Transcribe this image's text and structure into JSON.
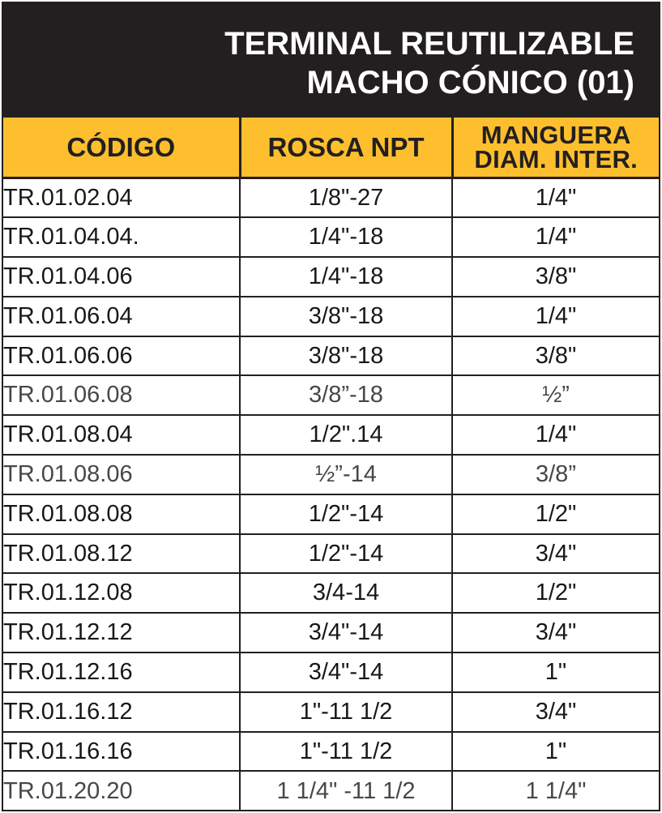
{
  "title": {
    "line1": "TERMINAL REUTILIZABLE",
    "line2": "MACHO CÓNICO (01)"
  },
  "headers": {
    "code": "CÓDIGO",
    "thread": "ROSCA NPT",
    "hose_line1": "MANGUERA",
    "hose_line2": "DIAM. INTER."
  },
  "rows": [
    {
      "code": "TR.01.02.04",
      "thread": "1/8\"-27",
      "hose": "1/4\""
    },
    {
      "code": "TR.01.04.04.",
      "thread": "1/4\"-18",
      "hose": "1/4\""
    },
    {
      "code": "TR.01.04.06",
      "thread": "1/4\"-18",
      "hose": "3/8\""
    },
    {
      "code": "TR.01.06.04",
      "thread": "3/8\"-18",
      "hose": "1/4\""
    },
    {
      "code": "TR.01.06.06",
      "thread": "3/8\"-18",
      "hose": "3/8\""
    },
    {
      "code": "TR.01.06.08",
      "thread": "3/8”-18",
      "hose": "½”"
    },
    {
      "code": "TR.01.08.04",
      "thread": "1/2\".14",
      "hose": "1/4\""
    },
    {
      "code": "TR.01.08.06",
      "thread": "½”-14",
      "hose": "3/8”"
    },
    {
      "code": "TR.01.08.08",
      "thread": "1/2\"-14",
      "hose": "1/2\""
    },
    {
      "code": "TR.01.08.12",
      "thread": "1/2\"-14",
      "hose": "3/4\""
    },
    {
      "code": "TR.01.12.08",
      "thread": "3/4-14",
      "hose": "1/2\""
    },
    {
      "code": "TR.01.12.12",
      "thread": "3/4\"-14",
      "hose": "3/4\""
    },
    {
      "code": "TR.01.12.16",
      "thread": "3/4\"-14",
      "hose": "1\""
    },
    {
      "code": "TR.01.16.12",
      "thread": "1\"-11 1/2",
      "hose": "3/4\""
    },
    {
      "code": "TR.01.16.16",
      "thread": "1\"-11 1/2",
      "hose": "1\""
    },
    {
      "code": "TR.01.20.20",
      "thread": "1 1/4\" -11 1/2",
      "hose": "1 1/4\""
    }
  ],
  "colors": {
    "header_band": "#231f20",
    "column_header": "#fdbf2d",
    "grid_lines": "#231f20"
  }
}
